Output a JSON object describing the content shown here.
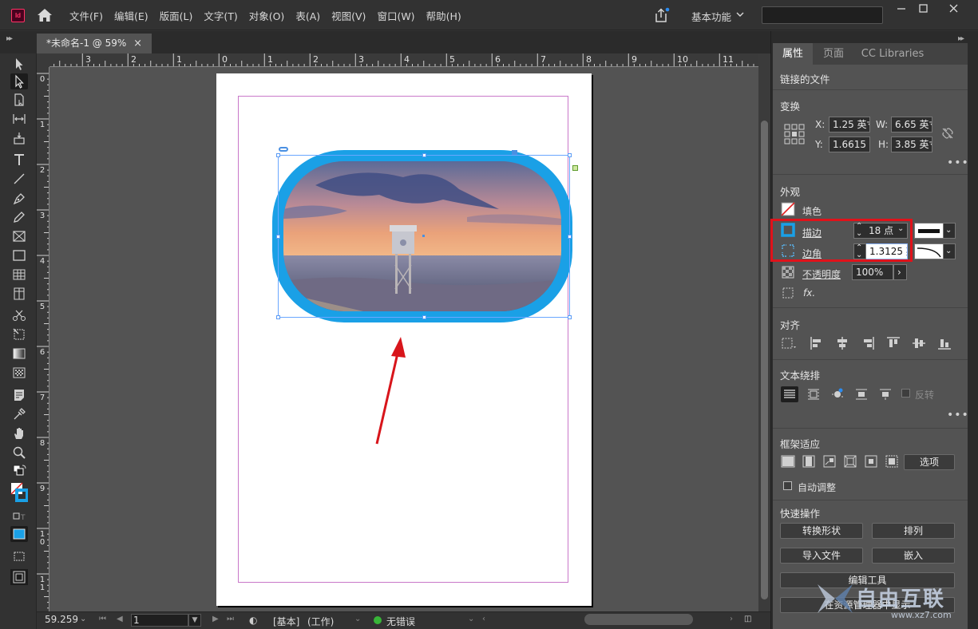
{
  "app": {
    "logo": "Id"
  },
  "menu": [
    "文件(F)",
    "编辑(E)",
    "版面(L)",
    "文字(T)",
    "对象(O)",
    "表(A)",
    "视图(V)",
    "窗口(W)",
    "帮助(H)"
  ],
  "workspace": "基本功能",
  "document_tab": {
    "title": "*未命名-1 @ 59%",
    "close": "×"
  },
  "rulers": {
    "h_labels": [
      "3",
      "2",
      "1",
      "0",
      "1",
      "2",
      "3",
      "4",
      "5",
      "6",
      "7",
      "8",
      "9",
      "10",
      "11"
    ],
    "v_labels": [
      "0",
      "1",
      "2",
      "3",
      "4",
      "5",
      "6",
      "7",
      "8",
      "9",
      "1\n0",
      "1\n1"
    ]
  },
  "status": {
    "zoom": "59.259",
    "page": "1",
    "master": "[基本]",
    "mode": "(工作)",
    "preflight": "无错误"
  },
  "panel": {
    "tabs": [
      "属性",
      "页面",
      "CC Libraries"
    ],
    "linked_file": "链接的文件",
    "transform": {
      "title": "变换",
      "x_label": "X:",
      "x_value": "1.25 英寸",
      "y_label": "Y:",
      "y_value": "1.6615 英",
      "w_label": "W:",
      "w_value": "6.65 英寸",
      "h_label": "H:",
      "h_value": "3.85 英寸"
    },
    "appearance": {
      "title": "外观",
      "fill_label": "填色",
      "stroke_label": "描边",
      "stroke_value": "18 点",
      "corner_label": "边角",
      "corner_value": "1.3125 英",
      "opacity_label": "不透明度",
      "opacity_value": "100%",
      "fx": "fx."
    },
    "align": {
      "title": "对齐"
    },
    "text_wrap": {
      "title": "文本绕排",
      "invert_label": "反转"
    },
    "frame_fitting": {
      "title": "框架适应",
      "options_button": "选项",
      "auto_fit_label": "自动调整"
    },
    "quick_actions": {
      "title": "快速操作",
      "convert_shape": "转换形状",
      "arrange": "排列",
      "import_file": "导入文件",
      "embed": "嵌入",
      "edit_tool": "编辑工具",
      "show_in_explorer": "在资源管理器中显示"
    }
  },
  "watermark": {
    "text": "自由互联",
    "url": "www.xz7.com"
  },
  "colors": {
    "accent": "#1aa0e6",
    "highlight": "#e0121a",
    "arrow": "#d8151b"
  }
}
